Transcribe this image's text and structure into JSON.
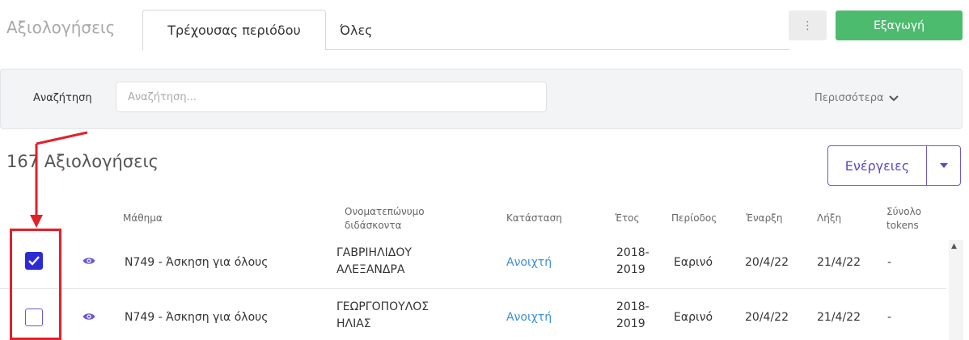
{
  "header": {
    "title": "Αξιολογήσεις",
    "tabs": [
      {
        "label": "Τρέχουσας περιόδου",
        "active": true
      },
      {
        "label": "Όλες",
        "active": false
      }
    ],
    "kebab_label": "⋮",
    "export_label": "Εξαγωγή"
  },
  "search": {
    "label": "Αναζήτηση",
    "placeholder": "Αναζήτηση...",
    "more_label": "Περισσότερα"
  },
  "results": {
    "count_title": "167 Αξιολογήσεις",
    "actions_label": "Ενέργειες"
  },
  "table": {
    "columns": {
      "course": "Μάθημα",
      "instructor": [
        "Ονοματεπώνυμο",
        "διδάσκοντα"
      ],
      "status": "Κατάσταση",
      "year": "Έτος",
      "period": "Περίοδος",
      "start": "Έναρξη",
      "end": "Λήξη",
      "tokens": [
        "Σύνολο",
        "tokens"
      ]
    },
    "rows": [
      {
        "checked": true,
        "course": "N749 - Άσκηση για όλους",
        "instructor": [
          "ΓΑΒΡΙΗΛΙΔΟΥ",
          "ΑΛΕΞΑΝΔΡΑ"
        ],
        "status": "Ανοιχτή",
        "year": [
          "2018-",
          "2019"
        ],
        "period": "Εαρινό",
        "start": "20/4/22",
        "end": "21/4/22",
        "tokens": "-"
      },
      {
        "checked": false,
        "course": "N749 - Άσκηση για όλους",
        "instructor": [
          "ΓΕΩΡΓΟΠΟΥΛΟΣ",
          "ΗΛΙΑΣ"
        ],
        "status": "Ανοιχτή",
        "year": [
          "2018-",
          "2019"
        ],
        "period": "Εαρινό",
        "start": "20/4/22",
        "end": "21/4/22",
        "tokens": "-"
      }
    ]
  },
  "colors": {
    "export_green": "#4dbb6e",
    "accent_purple": "#6a5acd",
    "checkbox_blue": "#2b2bd6",
    "status_blue": "#3d8fd6",
    "annotation_red": "#e0212a"
  }
}
